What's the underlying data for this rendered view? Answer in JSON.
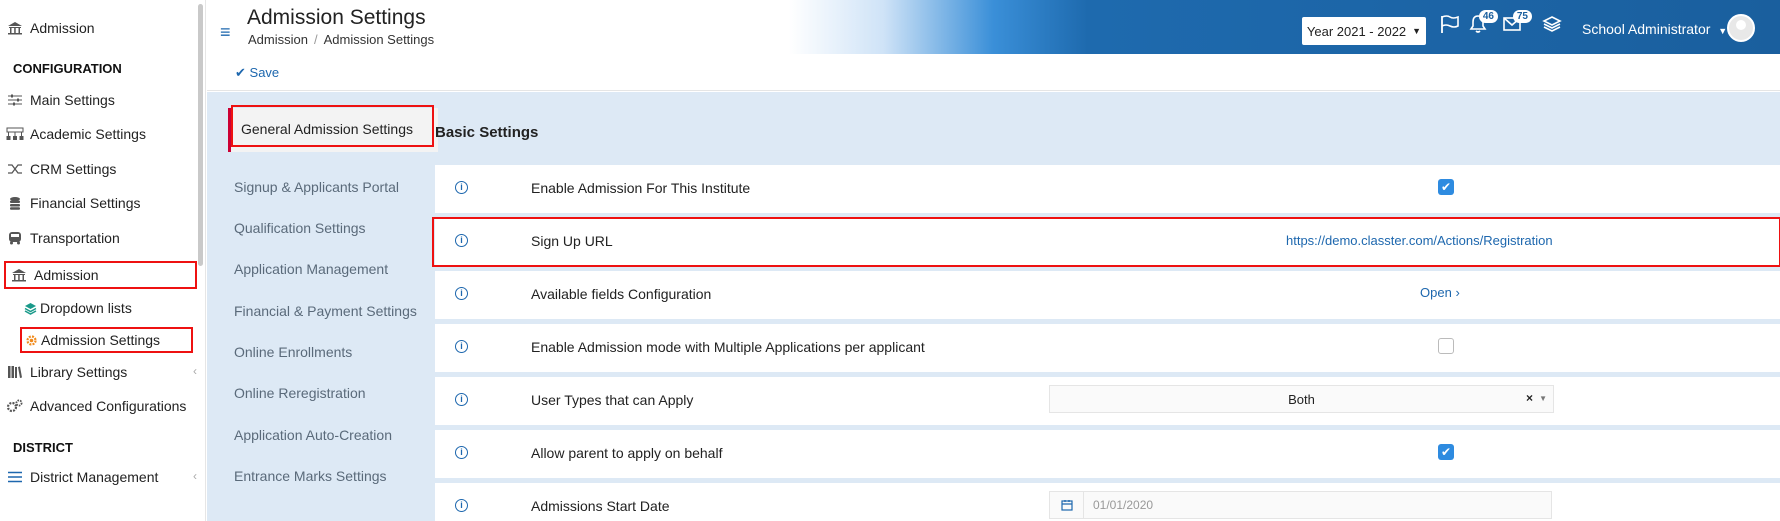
{
  "sidebar": {
    "top_item": "Admission",
    "config_heading": "CONFIGURATION",
    "items": [
      {
        "label": "Main Settings",
        "icon": "sliders-icon"
      },
      {
        "label": "Academic Settings",
        "icon": "org-chart-icon"
      },
      {
        "label": "CRM Settings",
        "icon": "shuffle-icon"
      },
      {
        "label": "Financial Settings",
        "icon": "coins-icon"
      },
      {
        "label": "Transportation",
        "icon": "bus-icon"
      },
      {
        "label": "Admission",
        "icon": "bank-icon"
      },
      {
        "label": "Dropdown lists",
        "icon": "layers-icon"
      },
      {
        "label": "Admission Settings",
        "icon": "gear-icon"
      },
      {
        "label": "Library Settings",
        "icon": "books-icon"
      },
      {
        "label": "Advanced Configurations",
        "icon": "gears-icon"
      }
    ],
    "district_heading": "DISTRICT",
    "district_item": "District Management"
  },
  "header": {
    "title": "Admission Settings",
    "breadcrumb": [
      "Admission",
      "Admission Settings"
    ],
    "year": "Year 2021 - 2022",
    "notifications": "46",
    "messages": "75",
    "user": "School Administrator"
  },
  "toolbar": {
    "save_label": "Save"
  },
  "subnav": {
    "active": "General Admission Settings",
    "items": [
      "Signup & Applicants Portal",
      "Qualification Settings",
      "Application Management",
      "Financial & Payment Settings",
      "Online Enrollments",
      "Online Reregistration",
      "Application Auto-Creation",
      "Entrance Marks Settings"
    ]
  },
  "main": {
    "section_title": "Basic Settings",
    "rows": [
      {
        "label": "Enable Admission For This Institute",
        "control": "checkbox",
        "checked": true
      },
      {
        "label": "Sign Up URL",
        "control": "link",
        "value": "https://demo.classter.com/Actions/Registration"
      },
      {
        "label": "Available fields Configuration",
        "control": "link",
        "value": "Open"
      },
      {
        "label": "Enable Admission mode with Multiple Applications per applicant",
        "control": "checkbox",
        "checked": false
      },
      {
        "label": "User Types that can Apply",
        "control": "select",
        "value": "Both"
      },
      {
        "label": "Allow parent to apply on behalf",
        "control": "checkbox",
        "checked": true
      },
      {
        "label": "Admissions Start Date",
        "control": "date",
        "value": "01/01/2020"
      }
    ]
  },
  "colors": {
    "accent": "#1d67ae",
    "header_dark": "#1a5f9e",
    "content_bg": "#dde9f5",
    "highlight": "#ee1111",
    "checkbox": "#2e8be0"
  }
}
